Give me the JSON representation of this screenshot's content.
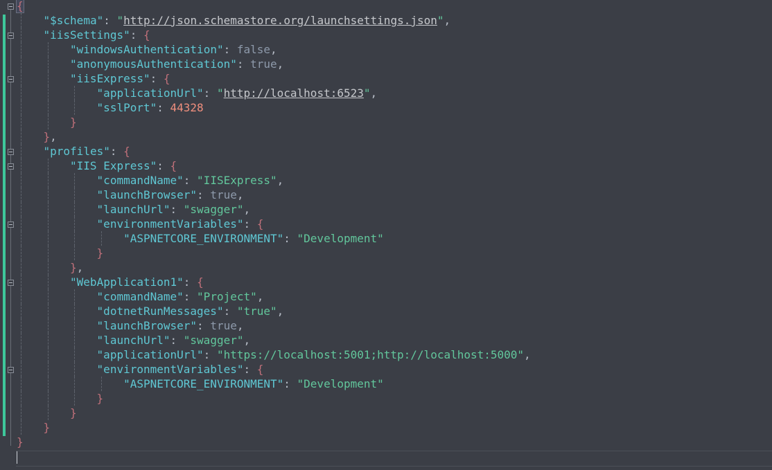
{
  "editor": {
    "lines": [
      {
        "indent": 0,
        "tokens": [
          {
            "t": "brace",
            "v": "{"
          }
        ]
      },
      {
        "indent": 1,
        "tokens": [
          {
            "t": "key",
            "v": "\"$schema\""
          },
          {
            "t": "punct",
            "v": ": "
          },
          {
            "t": "str",
            "v": "\""
          },
          {
            "t": "url",
            "v": "http://json.schemastore.org/launchsettings.json"
          },
          {
            "t": "str",
            "v": "\""
          },
          {
            "t": "punct",
            "v": ","
          }
        ]
      },
      {
        "indent": 1,
        "tokens": [
          {
            "t": "key",
            "v": "\"iisSettings\""
          },
          {
            "t": "punct",
            "v": ": "
          },
          {
            "t": "brace",
            "v": "{"
          }
        ]
      },
      {
        "indent": 2,
        "tokens": [
          {
            "t": "key",
            "v": "\"windowsAuthentication\""
          },
          {
            "t": "punct",
            "v": ": "
          },
          {
            "t": "kw",
            "v": "false"
          },
          {
            "t": "punct",
            "v": ","
          }
        ]
      },
      {
        "indent": 2,
        "tokens": [
          {
            "t": "key",
            "v": "\"anonymousAuthentication\""
          },
          {
            "t": "punct",
            "v": ": "
          },
          {
            "t": "kw",
            "v": "true"
          },
          {
            "t": "punct",
            "v": ","
          }
        ]
      },
      {
        "indent": 2,
        "tokens": [
          {
            "t": "key",
            "v": "\"iisExpress\""
          },
          {
            "t": "punct",
            "v": ": "
          },
          {
            "t": "brace",
            "v": "{"
          }
        ]
      },
      {
        "indent": 3,
        "tokens": [
          {
            "t": "key",
            "v": "\"applicationUrl\""
          },
          {
            "t": "punct",
            "v": ": "
          },
          {
            "t": "str",
            "v": "\""
          },
          {
            "t": "url",
            "v": "http://localhost:6523"
          },
          {
            "t": "str",
            "v": "\""
          },
          {
            "t": "punct",
            "v": ","
          }
        ]
      },
      {
        "indent": 3,
        "tokens": [
          {
            "t": "key",
            "v": "\"sslPort\""
          },
          {
            "t": "punct",
            "v": ": "
          },
          {
            "t": "num",
            "v": "44328"
          }
        ]
      },
      {
        "indent": 2,
        "tokens": [
          {
            "t": "brace",
            "v": "}"
          }
        ]
      },
      {
        "indent": 1,
        "tokens": [
          {
            "t": "brace",
            "v": "}"
          },
          {
            "t": "punct",
            "v": ","
          }
        ]
      },
      {
        "indent": 1,
        "tokens": [
          {
            "t": "key",
            "v": "\"profiles\""
          },
          {
            "t": "punct",
            "v": ": "
          },
          {
            "t": "brace",
            "v": "{"
          }
        ]
      },
      {
        "indent": 2,
        "tokens": [
          {
            "t": "key",
            "v": "\"IIS Express\""
          },
          {
            "t": "punct",
            "v": ": "
          },
          {
            "t": "brace",
            "v": "{"
          }
        ]
      },
      {
        "indent": 3,
        "tokens": [
          {
            "t": "key",
            "v": "\"commandName\""
          },
          {
            "t": "punct",
            "v": ": "
          },
          {
            "t": "str",
            "v": "\"IISExpress\""
          },
          {
            "t": "punct",
            "v": ","
          }
        ]
      },
      {
        "indent": 3,
        "tokens": [
          {
            "t": "key",
            "v": "\"launchBrowser\""
          },
          {
            "t": "punct",
            "v": ": "
          },
          {
            "t": "kw",
            "v": "true"
          },
          {
            "t": "punct",
            "v": ","
          }
        ]
      },
      {
        "indent": 3,
        "tokens": [
          {
            "t": "key",
            "v": "\"launchUrl\""
          },
          {
            "t": "punct",
            "v": ": "
          },
          {
            "t": "str",
            "v": "\"swagger\""
          },
          {
            "t": "punct",
            "v": ","
          }
        ]
      },
      {
        "indent": 3,
        "tokens": [
          {
            "t": "key",
            "v": "\"environmentVariables\""
          },
          {
            "t": "punct",
            "v": ": "
          },
          {
            "t": "brace",
            "v": "{"
          }
        ]
      },
      {
        "indent": 4,
        "tokens": [
          {
            "t": "key",
            "v": "\"ASPNETCORE_ENVIRONMENT\""
          },
          {
            "t": "punct",
            "v": ": "
          },
          {
            "t": "str",
            "v": "\"Development\""
          }
        ]
      },
      {
        "indent": 3,
        "tokens": [
          {
            "t": "brace",
            "v": "}"
          }
        ]
      },
      {
        "indent": 2,
        "tokens": [
          {
            "t": "brace",
            "v": "}"
          },
          {
            "t": "punct",
            "v": ","
          }
        ]
      },
      {
        "indent": 2,
        "tokens": [
          {
            "t": "key",
            "v": "\"WebApplication1\""
          },
          {
            "t": "punct",
            "v": ": "
          },
          {
            "t": "brace",
            "v": "{"
          }
        ]
      },
      {
        "indent": 3,
        "tokens": [
          {
            "t": "key",
            "v": "\"commandName\""
          },
          {
            "t": "punct",
            "v": ": "
          },
          {
            "t": "str",
            "v": "\"Project\""
          },
          {
            "t": "punct",
            "v": ","
          }
        ]
      },
      {
        "indent": 3,
        "tokens": [
          {
            "t": "key",
            "v": "\"dotnetRunMessages\""
          },
          {
            "t": "punct",
            "v": ": "
          },
          {
            "t": "str",
            "v": "\"true\""
          },
          {
            "t": "punct",
            "v": ","
          }
        ]
      },
      {
        "indent": 3,
        "tokens": [
          {
            "t": "key",
            "v": "\"launchBrowser\""
          },
          {
            "t": "punct",
            "v": ": "
          },
          {
            "t": "kw",
            "v": "true"
          },
          {
            "t": "punct",
            "v": ","
          }
        ]
      },
      {
        "indent": 3,
        "tokens": [
          {
            "t": "key",
            "v": "\"launchUrl\""
          },
          {
            "t": "punct",
            "v": ": "
          },
          {
            "t": "str",
            "v": "\"swagger\""
          },
          {
            "t": "punct",
            "v": ","
          }
        ]
      },
      {
        "indent": 3,
        "tokens": [
          {
            "t": "key",
            "v": "\"applicationUrl\""
          },
          {
            "t": "punct",
            "v": ": "
          },
          {
            "t": "str",
            "v": "\"https://localhost:5001;http://localhost:5000\""
          },
          {
            "t": "punct",
            "v": ","
          }
        ]
      },
      {
        "indent": 3,
        "tokens": [
          {
            "t": "key",
            "v": "\"environmentVariables\""
          },
          {
            "t": "punct",
            "v": ": "
          },
          {
            "t": "brace",
            "v": "{"
          }
        ]
      },
      {
        "indent": 4,
        "tokens": [
          {
            "t": "key",
            "v": "\"ASPNETCORE_ENVIRONMENT\""
          },
          {
            "t": "punct",
            "v": ": "
          },
          {
            "t": "str",
            "v": "\"Development\""
          }
        ]
      },
      {
        "indent": 3,
        "tokens": [
          {
            "t": "brace",
            "v": "}"
          }
        ]
      },
      {
        "indent": 2,
        "tokens": [
          {
            "t": "brace",
            "v": "}"
          }
        ]
      },
      {
        "indent": 1,
        "tokens": [
          {
            "t": "brace",
            "v": "}"
          }
        ]
      },
      {
        "indent": 0,
        "tokens": [
          {
            "t": "brace",
            "v": "}"
          }
        ]
      }
    ],
    "fold_markers_on_lines": [
      0,
      2,
      5,
      10,
      11,
      15,
      19,
      25
    ],
    "colors": {
      "background": "#3b3e46",
      "key": "#5fc8d4",
      "string": "#62c79c",
      "keyword": "#8e9aab",
      "number": "#f08f7e",
      "brace": "#c0707a",
      "change_bar": "#3ec79b"
    }
  }
}
